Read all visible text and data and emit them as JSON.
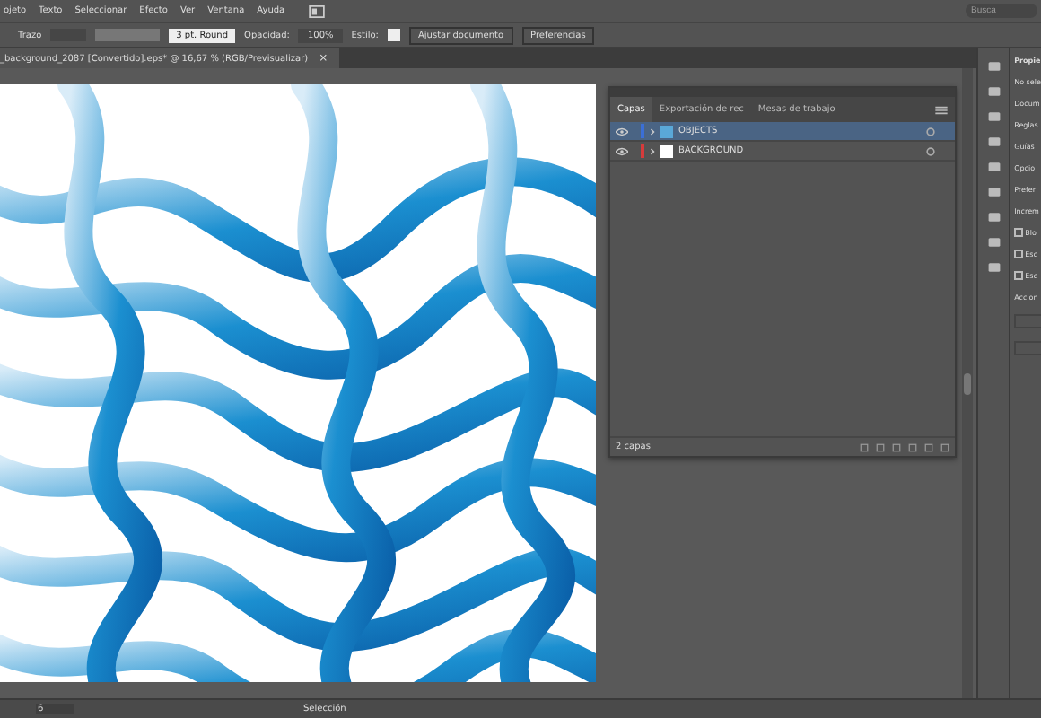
{
  "menu": [
    "ojeto",
    "Texto",
    "Seleccionar",
    "Efecto",
    "Ver",
    "Ventana",
    "Ayuda"
  ],
  "control_bar": {
    "stroke_label": "Trazo",
    "brush": "3 pt. Round",
    "opacity_label": "Opacidad:",
    "opacity": "100%",
    "style_label": "Estilo:",
    "buttons": [
      "Ajustar documento",
      "Preferencias"
    ]
  },
  "search": {
    "placeholder": "Busca"
  },
  "document_tab": {
    "title": "_background_2087 [Convertido].eps* @ 16,67 % (RGB/Previsualizar)",
    "close": "×"
  },
  "layers_panel": {
    "tabs": [
      {
        "label": "Capas",
        "selected": true
      },
      {
        "label": "Exportación de rec",
        "selected": false
      },
      {
        "label": "Mesas de trabajo",
        "selected": false
      }
    ],
    "layers": [
      {
        "name": "OBJECTS",
        "color": "#3b6fd6",
        "selected": true
      },
      {
        "name": "BACKGROUND",
        "color": "#d63b3b",
        "selected": false
      }
    ],
    "footer": "2 capas"
  },
  "properties_panel": {
    "title": "Propie",
    "lines": [
      "No sele",
      "Docum",
      "Reglas",
      "Guías",
      "Opcio",
      "Prefer",
      "Increm"
    ],
    "checkboxes": [
      {
        "label": "Blo",
        "checked": false
      },
      {
        "label": "Esc",
        "checked": false
      },
      {
        "label": "Esc",
        "checked": false
      }
    ],
    "actions_label": "Accion"
  },
  "status_bar": {
    "zoom": "6",
    "tool": "Selección"
  }
}
